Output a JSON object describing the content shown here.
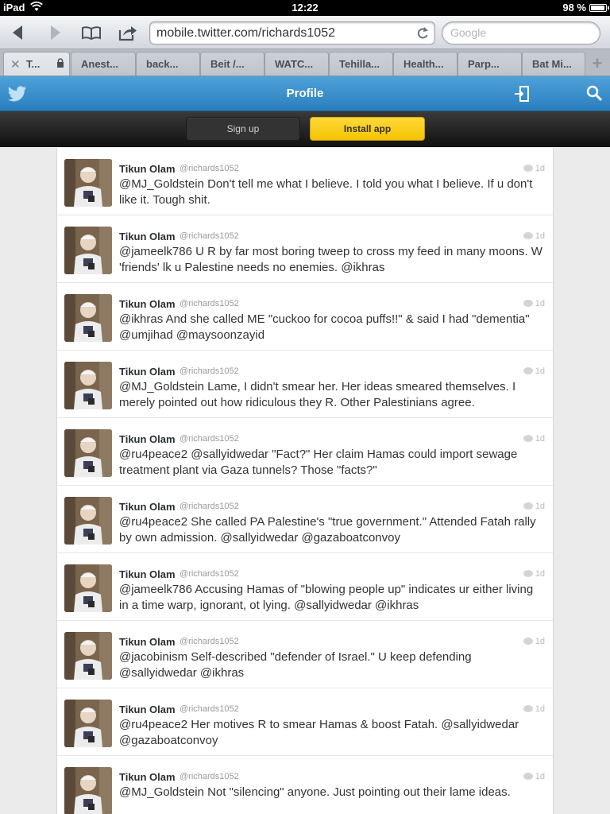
{
  "status_bar": {
    "carrier": "iPad",
    "time": "12:22",
    "battery": "98 %"
  },
  "browser": {
    "url": "mobile.twitter.com/richards1052",
    "search_placeholder": "Google",
    "tabs": [
      {
        "label": "T...",
        "active": true
      },
      {
        "label": "Anest..."
      },
      {
        "label": "back..."
      },
      {
        "label": "Beit /..."
      },
      {
        "label": "WATC..."
      },
      {
        "label": "Tehilla..."
      },
      {
        "label": "Health..."
      },
      {
        "label": "Parp..."
      },
      {
        "label": "Bat Mi..."
      }
    ]
  },
  "header": {
    "title": "Profile"
  },
  "cta": {
    "signup": "Sign up",
    "install": "Install app"
  },
  "tweets": [
    {
      "name": "Tikun Olam",
      "handle": "@richards1052",
      "time": "1d",
      "text": "@MJ_Goldstein Don't tell me what I believe. I told you what I believe. If u don't like it. Tough shit."
    },
    {
      "name": "Tikun Olam",
      "handle": "@richards1052",
      "time": "1d",
      "text": "@jameelk786 U R by far most boring tweep to cross my feed in many moons. W 'friends' lk u Palestine needs no enemies. @ikhras"
    },
    {
      "name": "Tikun Olam",
      "handle": "@richards1052",
      "time": "1d",
      "text": "@ikhras And she called ME \"cuckoo for cocoa puffs!!\" & said I had \"dementia\" @umjihad @maysoonzayid"
    },
    {
      "name": "Tikun Olam",
      "handle": "@richards1052",
      "time": "1d",
      "text": "@MJ_Goldstein Lame, I didn't smear her. Her ideas smeared themselves. I merely pointed out how ridiculous they R. Other Palestinians agree."
    },
    {
      "name": "Tikun Olam",
      "handle": "@richards1052",
      "time": "1d",
      "text": "@ru4peace2 @sallyidwedar \"Fact?\" Her claim Hamas could import sewage treatment plant via Gaza tunnels? Those \"facts?\""
    },
    {
      "name": "Tikun Olam",
      "handle": "@richards1052",
      "time": "1d",
      "text": "@ru4peace2 She called PA Palestine's \"true government.\" Attended Fatah rally by own admission. @sallyidwedar @gazaboatconvoy"
    },
    {
      "name": "Tikun Olam",
      "handle": "@richards1052",
      "time": "1d",
      "text": "@jameelk786 Accusing Hamas of \"blowing people up\" indicates ur either living in a time warp, ignorant, ot lying. @sallyidwedar @ikhras"
    },
    {
      "name": "Tikun Olam",
      "handle": "@richards1052",
      "time": "1d",
      "text": "@jacobinism Self-described \"defender of Israel.\" U keep defending @sallyidwedar @ikhras"
    },
    {
      "name": "Tikun Olam",
      "handle": "@richards1052",
      "time": "1d",
      "text": "@ru4peace2 Her motives R to smear Hamas & boost Fatah. @sallyidwedar @gazaboatconvoy"
    },
    {
      "name": "Tikun Olam",
      "handle": "@richards1052",
      "time": "1d",
      "text": "@MJ_Goldstein Not \"silencing\" anyone. Just pointing out their lame ideas."
    }
  ]
}
